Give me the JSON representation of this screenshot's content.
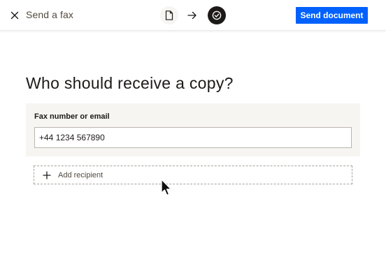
{
  "header": {
    "title": "Send a fax",
    "send_label": "Send document",
    "steps": [
      {
        "name": "document",
        "icon": "document-icon",
        "state": "current"
      },
      {
        "name": "arrow",
        "icon": "arrow-right-icon"
      },
      {
        "name": "done",
        "icon": "check-circle-icon",
        "state": "complete"
      }
    ]
  },
  "main": {
    "heading": "Who should receive a copy?",
    "recipient": {
      "label": "Fax number or email",
      "value": "+44 1234 567890"
    },
    "add_recipient_label": "Add recipient"
  },
  "colors": {
    "accent": "#0061fe",
    "text": "#1e1919",
    "card_bg": "#f7f5f2",
    "step_done_bg": "#1e1919"
  }
}
